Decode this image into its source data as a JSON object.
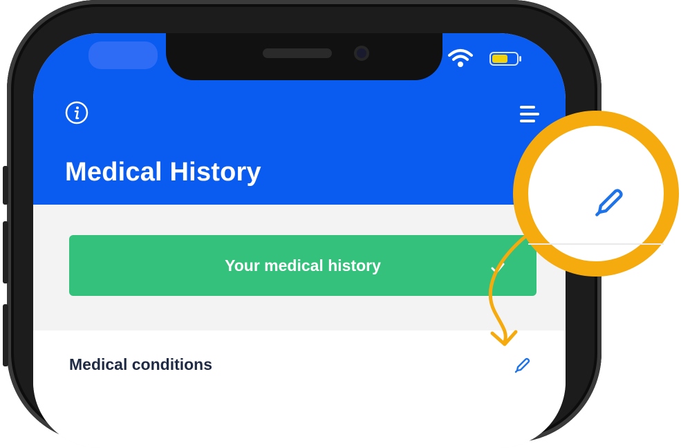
{
  "header": {
    "title": "Medical History",
    "background_color": "#0a5cf0"
  },
  "actions": {
    "medical_history_button": "Your medical history",
    "button_color": "#34c17c"
  },
  "list": {
    "rows": [
      {
        "label": "Medical conditions"
      }
    ]
  },
  "annotation": {
    "highlight_color": "#f5aa0e",
    "icon": "pencil-icon"
  }
}
